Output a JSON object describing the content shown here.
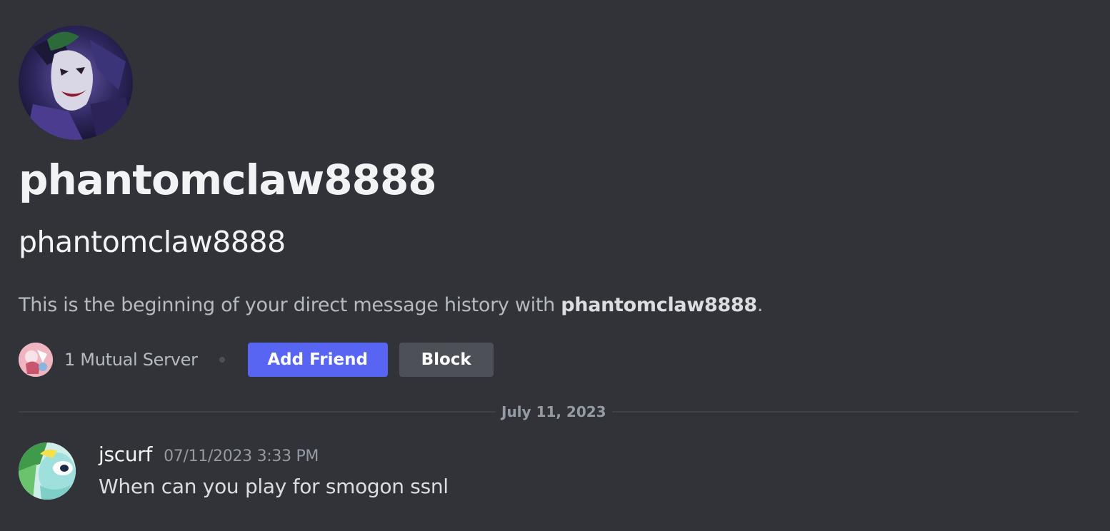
{
  "profile": {
    "display_name": "phantomclaw8888",
    "username": "phantomclaw8888",
    "avatar_icon": "joker-avatar-icon"
  },
  "intro": {
    "text_prefix": "This is the beginning of your direct message history with ",
    "name": "phantomclaw8888",
    "text_suffix": "."
  },
  "mutual": {
    "label": "1 Mutual Server",
    "server_icon": "server-icon"
  },
  "actions": {
    "add_friend_label": "Add Friend",
    "block_label": "Block"
  },
  "divider": {
    "date": "July 11, 2023"
  },
  "messages": [
    {
      "author": "jscurf",
      "timestamp": "07/11/2023 3:33 PM",
      "content": "When can you play for smogon ssnl",
      "avatar_icon": "user-avatar-icon"
    }
  ],
  "colors": {
    "background": "#313338",
    "brand": "#5865f2",
    "secondary_button": "#4e5058",
    "muted_text": "#949ba4"
  }
}
